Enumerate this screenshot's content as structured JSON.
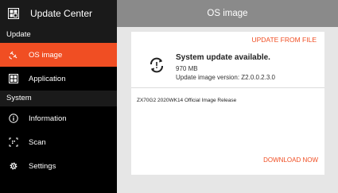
{
  "app": {
    "title": "Update Center"
  },
  "header": {
    "title": "OS image"
  },
  "sidebar": {
    "sections": [
      {
        "label": "Update"
      },
      {
        "label": "System"
      }
    ],
    "items": [
      {
        "label": "OS image",
        "icon": "satellite-icon"
      },
      {
        "label": "Application",
        "icon": "apps-grid-icon"
      },
      {
        "label": "Information",
        "icon": "info-icon"
      },
      {
        "label": "Scan",
        "icon": "scan-icon"
      },
      {
        "label": "Settings",
        "icon": "gear-icon"
      }
    ]
  },
  "card": {
    "update_from_file": "UPDATE FROM FILE",
    "status_title": "System update available.",
    "size": "970 MB",
    "version": "Update image version: Z2.0.0.2.3.0",
    "release_name": "ZX70G2 2020WK14 Official Image Release",
    "download_now": "DOWNLOAD NOW"
  },
  "colors": {
    "accent": "#f04e23",
    "sidebar_bg": "#000000",
    "header_bg": "#8a8a8a"
  }
}
